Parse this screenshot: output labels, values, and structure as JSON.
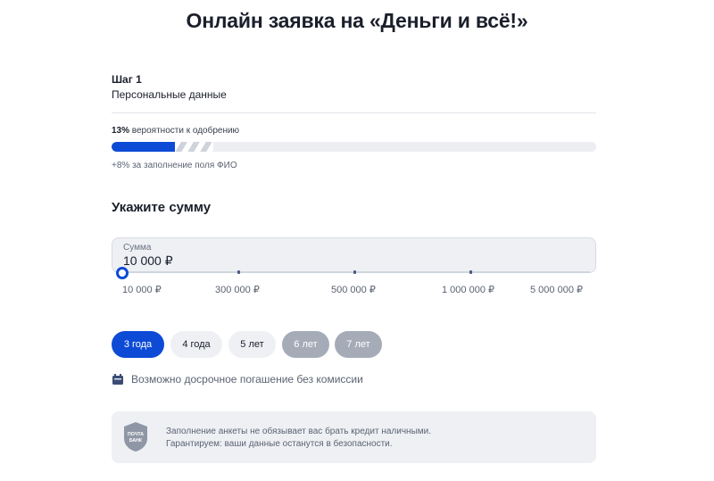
{
  "page_title": "Онлайн заявка на «Деньги и всё!»",
  "step": {
    "label": "Шаг 1",
    "name": "Персональные данные"
  },
  "approval": {
    "percent_text": "13%",
    "suffix": " вероятности к одобрению",
    "percent_value": 13,
    "bonus_value": 8,
    "bonus_text": "+8% за заполнение поля ФИО"
  },
  "amount_section": {
    "title": "Укажите сумму",
    "field_label": "Сумма",
    "field_value": "10 000 ₽",
    "slider_marks": [
      "10 000 ₽",
      "300 000 ₽",
      "500 000 ₽",
      "1 000 000 ₽",
      "5 000 000 ₽"
    ],
    "slider_value_index": 0
  },
  "terms": [
    {
      "label": "3 года",
      "state": "selected"
    },
    {
      "label": "4 года",
      "state": "normal"
    },
    {
      "label": "5 лет",
      "state": "normal"
    },
    {
      "label": "6 лет",
      "state": "disabled"
    },
    {
      "label": "7 лет",
      "state": "disabled"
    }
  ],
  "early_repayment_text": "Возможно досрочное погашение без комиссии",
  "info": {
    "logo_text_line1": "ПОЧТА",
    "logo_text_line2": "БАНК",
    "line1": "Заполнение анкеты не обязывает вас брать кредит наличными.",
    "line2": "Гарантируем: ваши данные останутся в безопасности."
  },
  "colors": {
    "accent": "#0d4bd6",
    "disabled_pill": "#a5acb8",
    "field_bg": "#eef0f4"
  },
  "icons": {
    "early_repayment": "calendar-crown-icon",
    "bank_logo": "pochta-bank-shield-icon"
  }
}
